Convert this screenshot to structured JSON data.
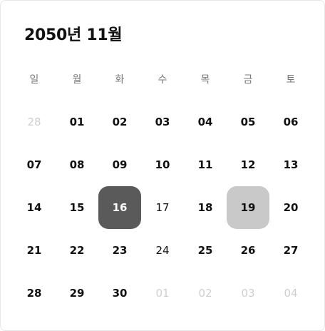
{
  "calendar": {
    "title": "2050년 11월",
    "weekdays": [
      "일",
      "월",
      "화",
      "수",
      "목",
      "금",
      "토"
    ],
    "weeks": [
      [
        {
          "label": "28",
          "state": "muted"
        },
        {
          "label": "01",
          "state": "normal"
        },
        {
          "label": "02",
          "state": "normal"
        },
        {
          "label": "03",
          "state": "normal"
        },
        {
          "label": "04",
          "state": "normal"
        },
        {
          "label": "05",
          "state": "normal"
        },
        {
          "label": "06",
          "state": "normal"
        }
      ],
      [
        {
          "label": "07",
          "state": "normal"
        },
        {
          "label": "08",
          "state": "normal"
        },
        {
          "label": "09",
          "state": "normal"
        },
        {
          "label": "10",
          "state": "normal"
        },
        {
          "label": "11",
          "state": "normal"
        },
        {
          "label": "12",
          "state": "normal"
        },
        {
          "label": "13",
          "state": "normal"
        }
      ],
      [
        {
          "label": "14",
          "state": "normal"
        },
        {
          "label": "15",
          "state": "normal"
        },
        {
          "label": "16",
          "state": "selected-dark"
        },
        {
          "label": "17",
          "state": "plain"
        },
        {
          "label": "18",
          "state": "normal"
        },
        {
          "label": "19",
          "state": "selected-light"
        },
        {
          "label": "20",
          "state": "normal"
        }
      ],
      [
        {
          "label": "21",
          "state": "normal"
        },
        {
          "label": "22",
          "state": "normal"
        },
        {
          "label": "23",
          "state": "normal"
        },
        {
          "label": "24",
          "state": "plain"
        },
        {
          "label": "25",
          "state": "normal"
        },
        {
          "label": "26",
          "state": "normal"
        },
        {
          "label": "27",
          "state": "normal"
        }
      ],
      [
        {
          "label": "28",
          "state": "normal"
        },
        {
          "label": "29",
          "state": "normal"
        },
        {
          "label": "30",
          "state": "normal"
        },
        {
          "label": "01",
          "state": "muted"
        },
        {
          "label": "02",
          "state": "muted"
        },
        {
          "label": "03",
          "state": "muted"
        },
        {
          "label": "04",
          "state": "muted"
        }
      ]
    ],
    "colors": {
      "selected_dark": "#5a5a5a",
      "selected_light": "#c9c9c9",
      "muted": "#cfcfcf"
    }
  }
}
